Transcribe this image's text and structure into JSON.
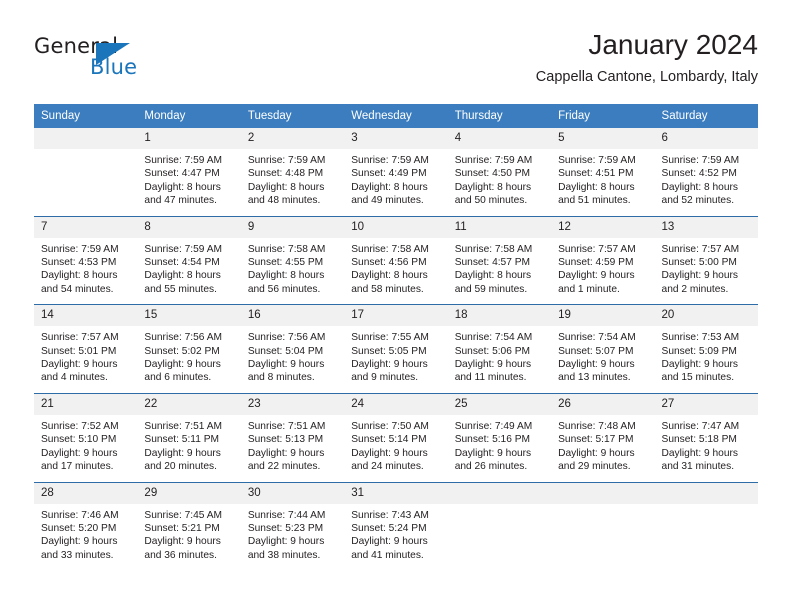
{
  "brand": {
    "name_part1": "General",
    "name_part2": "Blue",
    "accent_color": "#1b75bb",
    "logo_icon": "triangle-icon"
  },
  "header": {
    "title": "January 2024",
    "subtitle": "Cappella Cantone, Lombardy, Italy"
  },
  "calendar": {
    "header_bg": "#3b7dbf",
    "row_divider_color": "#2e6ca8",
    "daynum_bg": "#f1f1f1",
    "weekday_headers": [
      "Sunday",
      "Monday",
      "Tuesday",
      "Wednesday",
      "Thursday",
      "Friday",
      "Saturday"
    ],
    "weeks": [
      [
        {
          "day": "",
          "sunrise": "",
          "sunset": "",
          "daylight_line1": "",
          "daylight_line2": ""
        },
        {
          "day": "1",
          "sunrise": "Sunrise: 7:59 AM",
          "sunset": "Sunset: 4:47 PM",
          "daylight_line1": "Daylight: 8 hours",
          "daylight_line2": "and 47 minutes."
        },
        {
          "day": "2",
          "sunrise": "Sunrise: 7:59 AM",
          "sunset": "Sunset: 4:48 PM",
          "daylight_line1": "Daylight: 8 hours",
          "daylight_line2": "and 48 minutes."
        },
        {
          "day": "3",
          "sunrise": "Sunrise: 7:59 AM",
          "sunset": "Sunset: 4:49 PM",
          "daylight_line1": "Daylight: 8 hours",
          "daylight_line2": "and 49 minutes."
        },
        {
          "day": "4",
          "sunrise": "Sunrise: 7:59 AM",
          "sunset": "Sunset: 4:50 PM",
          "daylight_line1": "Daylight: 8 hours",
          "daylight_line2": "and 50 minutes."
        },
        {
          "day": "5",
          "sunrise": "Sunrise: 7:59 AM",
          "sunset": "Sunset: 4:51 PM",
          "daylight_line1": "Daylight: 8 hours",
          "daylight_line2": "and 51 minutes."
        },
        {
          "day": "6",
          "sunrise": "Sunrise: 7:59 AM",
          "sunset": "Sunset: 4:52 PM",
          "daylight_line1": "Daylight: 8 hours",
          "daylight_line2": "and 52 minutes."
        }
      ],
      [
        {
          "day": "7",
          "sunrise": "Sunrise: 7:59 AM",
          "sunset": "Sunset: 4:53 PM",
          "daylight_line1": "Daylight: 8 hours",
          "daylight_line2": "and 54 minutes."
        },
        {
          "day": "8",
          "sunrise": "Sunrise: 7:59 AM",
          "sunset": "Sunset: 4:54 PM",
          "daylight_line1": "Daylight: 8 hours",
          "daylight_line2": "and 55 minutes."
        },
        {
          "day": "9",
          "sunrise": "Sunrise: 7:58 AM",
          "sunset": "Sunset: 4:55 PM",
          "daylight_line1": "Daylight: 8 hours",
          "daylight_line2": "and 56 minutes."
        },
        {
          "day": "10",
          "sunrise": "Sunrise: 7:58 AM",
          "sunset": "Sunset: 4:56 PM",
          "daylight_line1": "Daylight: 8 hours",
          "daylight_line2": "and 58 minutes."
        },
        {
          "day": "11",
          "sunrise": "Sunrise: 7:58 AM",
          "sunset": "Sunset: 4:57 PM",
          "daylight_line1": "Daylight: 8 hours",
          "daylight_line2": "and 59 minutes."
        },
        {
          "day": "12",
          "sunrise": "Sunrise: 7:57 AM",
          "sunset": "Sunset: 4:59 PM",
          "daylight_line1": "Daylight: 9 hours",
          "daylight_line2": "and 1 minute."
        },
        {
          "day": "13",
          "sunrise": "Sunrise: 7:57 AM",
          "sunset": "Sunset: 5:00 PM",
          "daylight_line1": "Daylight: 9 hours",
          "daylight_line2": "and 2 minutes."
        }
      ],
      [
        {
          "day": "14",
          "sunrise": "Sunrise: 7:57 AM",
          "sunset": "Sunset: 5:01 PM",
          "daylight_line1": "Daylight: 9 hours",
          "daylight_line2": "and 4 minutes."
        },
        {
          "day": "15",
          "sunrise": "Sunrise: 7:56 AM",
          "sunset": "Sunset: 5:02 PM",
          "daylight_line1": "Daylight: 9 hours",
          "daylight_line2": "and 6 minutes."
        },
        {
          "day": "16",
          "sunrise": "Sunrise: 7:56 AM",
          "sunset": "Sunset: 5:04 PM",
          "daylight_line1": "Daylight: 9 hours",
          "daylight_line2": "and 8 minutes."
        },
        {
          "day": "17",
          "sunrise": "Sunrise: 7:55 AM",
          "sunset": "Sunset: 5:05 PM",
          "daylight_line1": "Daylight: 9 hours",
          "daylight_line2": "and 9 minutes."
        },
        {
          "day": "18",
          "sunrise": "Sunrise: 7:54 AM",
          "sunset": "Sunset: 5:06 PM",
          "daylight_line1": "Daylight: 9 hours",
          "daylight_line2": "and 11 minutes."
        },
        {
          "day": "19",
          "sunrise": "Sunrise: 7:54 AM",
          "sunset": "Sunset: 5:07 PM",
          "daylight_line1": "Daylight: 9 hours",
          "daylight_line2": "and 13 minutes."
        },
        {
          "day": "20",
          "sunrise": "Sunrise: 7:53 AM",
          "sunset": "Sunset: 5:09 PM",
          "daylight_line1": "Daylight: 9 hours",
          "daylight_line2": "and 15 minutes."
        }
      ],
      [
        {
          "day": "21",
          "sunrise": "Sunrise: 7:52 AM",
          "sunset": "Sunset: 5:10 PM",
          "daylight_line1": "Daylight: 9 hours",
          "daylight_line2": "and 17 minutes."
        },
        {
          "day": "22",
          "sunrise": "Sunrise: 7:51 AM",
          "sunset": "Sunset: 5:11 PM",
          "daylight_line1": "Daylight: 9 hours",
          "daylight_line2": "and 20 minutes."
        },
        {
          "day": "23",
          "sunrise": "Sunrise: 7:51 AM",
          "sunset": "Sunset: 5:13 PM",
          "daylight_line1": "Daylight: 9 hours",
          "daylight_line2": "and 22 minutes."
        },
        {
          "day": "24",
          "sunrise": "Sunrise: 7:50 AM",
          "sunset": "Sunset: 5:14 PM",
          "daylight_line1": "Daylight: 9 hours",
          "daylight_line2": "and 24 minutes."
        },
        {
          "day": "25",
          "sunrise": "Sunrise: 7:49 AM",
          "sunset": "Sunset: 5:16 PM",
          "daylight_line1": "Daylight: 9 hours",
          "daylight_line2": "and 26 minutes."
        },
        {
          "day": "26",
          "sunrise": "Sunrise: 7:48 AM",
          "sunset": "Sunset: 5:17 PM",
          "daylight_line1": "Daylight: 9 hours",
          "daylight_line2": "and 29 minutes."
        },
        {
          "day": "27",
          "sunrise": "Sunrise: 7:47 AM",
          "sunset": "Sunset: 5:18 PM",
          "daylight_line1": "Daylight: 9 hours",
          "daylight_line2": "and 31 minutes."
        }
      ],
      [
        {
          "day": "28",
          "sunrise": "Sunrise: 7:46 AM",
          "sunset": "Sunset: 5:20 PM",
          "daylight_line1": "Daylight: 9 hours",
          "daylight_line2": "and 33 minutes."
        },
        {
          "day": "29",
          "sunrise": "Sunrise: 7:45 AM",
          "sunset": "Sunset: 5:21 PM",
          "daylight_line1": "Daylight: 9 hours",
          "daylight_line2": "and 36 minutes."
        },
        {
          "day": "30",
          "sunrise": "Sunrise: 7:44 AM",
          "sunset": "Sunset: 5:23 PM",
          "daylight_line1": "Daylight: 9 hours",
          "daylight_line2": "and 38 minutes."
        },
        {
          "day": "31",
          "sunrise": "Sunrise: 7:43 AM",
          "sunset": "Sunset: 5:24 PM",
          "daylight_line1": "Daylight: 9 hours",
          "daylight_line2": "and 41 minutes."
        },
        {
          "day": "",
          "sunrise": "",
          "sunset": "",
          "daylight_line1": "",
          "daylight_line2": ""
        },
        {
          "day": "",
          "sunrise": "",
          "sunset": "",
          "daylight_line1": "",
          "daylight_line2": ""
        },
        {
          "day": "",
          "sunrise": "",
          "sunset": "",
          "daylight_line1": "",
          "daylight_line2": ""
        }
      ]
    ]
  }
}
